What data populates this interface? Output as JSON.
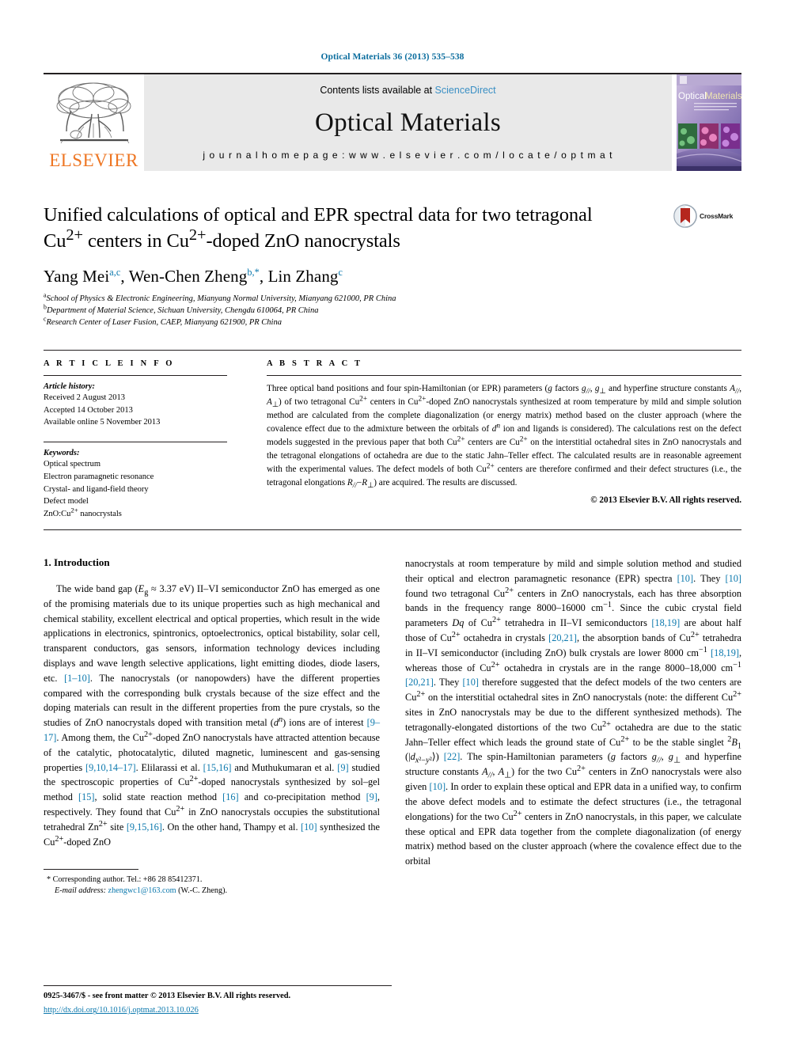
{
  "running_head": "Optical Materials 36 (2013) 535–538",
  "masthead": {
    "publisher": "ELSEVIER",
    "contents_prefix": "Contents lists available at ",
    "contents_link": "ScienceDirect",
    "journal_name": "Optical Materials",
    "homepage": "j o u r n a l   h o m e p a g e :   w w w . e l s e v i e r . c o m / l o c a t e / o p t m a t",
    "cover_title_1": "Optical",
    "cover_title_2": "Materials"
  },
  "article": {
    "title_line1_a": "Unified calculations of optical and EPR spectral data for two tetragonal",
    "title_line2_a": "Cu",
    "title_line2_sup1": "2+",
    "title_line2_b": " centers in Cu",
    "title_line2_sup2": "2+",
    "title_line2_c": "-doped ZnO nanocrystals",
    "crossmark_label": "CrossMark",
    "authors": [
      {
        "name": "Yang Mei",
        "marks": "a,c",
        "sep": ", "
      },
      {
        "name": "Wen-Chen Zheng",
        "marks": "b,*",
        "sep": ", "
      },
      {
        "name": "Lin Zhang",
        "marks": "c",
        "sep": ""
      }
    ],
    "affiliations": [
      {
        "mark": "a",
        "text": "School of Physics & Electronic Engineering, Mianyang Normal University, Mianyang 621000, PR China"
      },
      {
        "mark": "b",
        "text": "Department of Material Science, Sichuan University, Chengdu 610064, PR China"
      },
      {
        "mark": "c",
        "text": "Research Center of Laser Fusion, CAEP, Mianyang 621900, PR China"
      }
    ]
  },
  "article_info": {
    "heading": "A R T I C L E  I N F O",
    "history_title": "Article history:",
    "history": [
      "Received 2 August 2013",
      "Accepted 14 October 2013",
      "Available online 5 November 2013"
    ],
    "keywords_title": "Keywords:",
    "keywords": [
      "Optical spectrum",
      "Electron paramagnetic resonance",
      "Crystal- and ligand-field theory",
      "Defect model",
      "ZnO:Cu2+ nanocrystals"
    ]
  },
  "abstract": {
    "heading": "A B S T R A C T",
    "copyright": "© 2013 Elsevier B.V. All rights reserved."
  },
  "introduction": {
    "heading": "1. Introduction"
  },
  "footnote": {
    "star": "*",
    "corresponding": "Corresponding author. Tel.: +86 28 85412371.",
    "email_label": "E-mail address:",
    "email": "zhengwc1@163.com",
    "email_suffix": "(W.-C. Zheng)."
  },
  "footer": {
    "issn_line": "0925-3467/$ - see front matter © 2013 Elsevier B.V. All rights reserved.",
    "doi": "http://dx.doi.org/10.1016/j.optmat.2013.10.026"
  },
  "colors": {
    "link": "#0b78ad",
    "running_head": "#0b6d9e",
    "elsevier_orange": "#ee7623",
    "banner_gray": "#e9e9e9",
    "crossmark_red": "#b5261e"
  }
}
